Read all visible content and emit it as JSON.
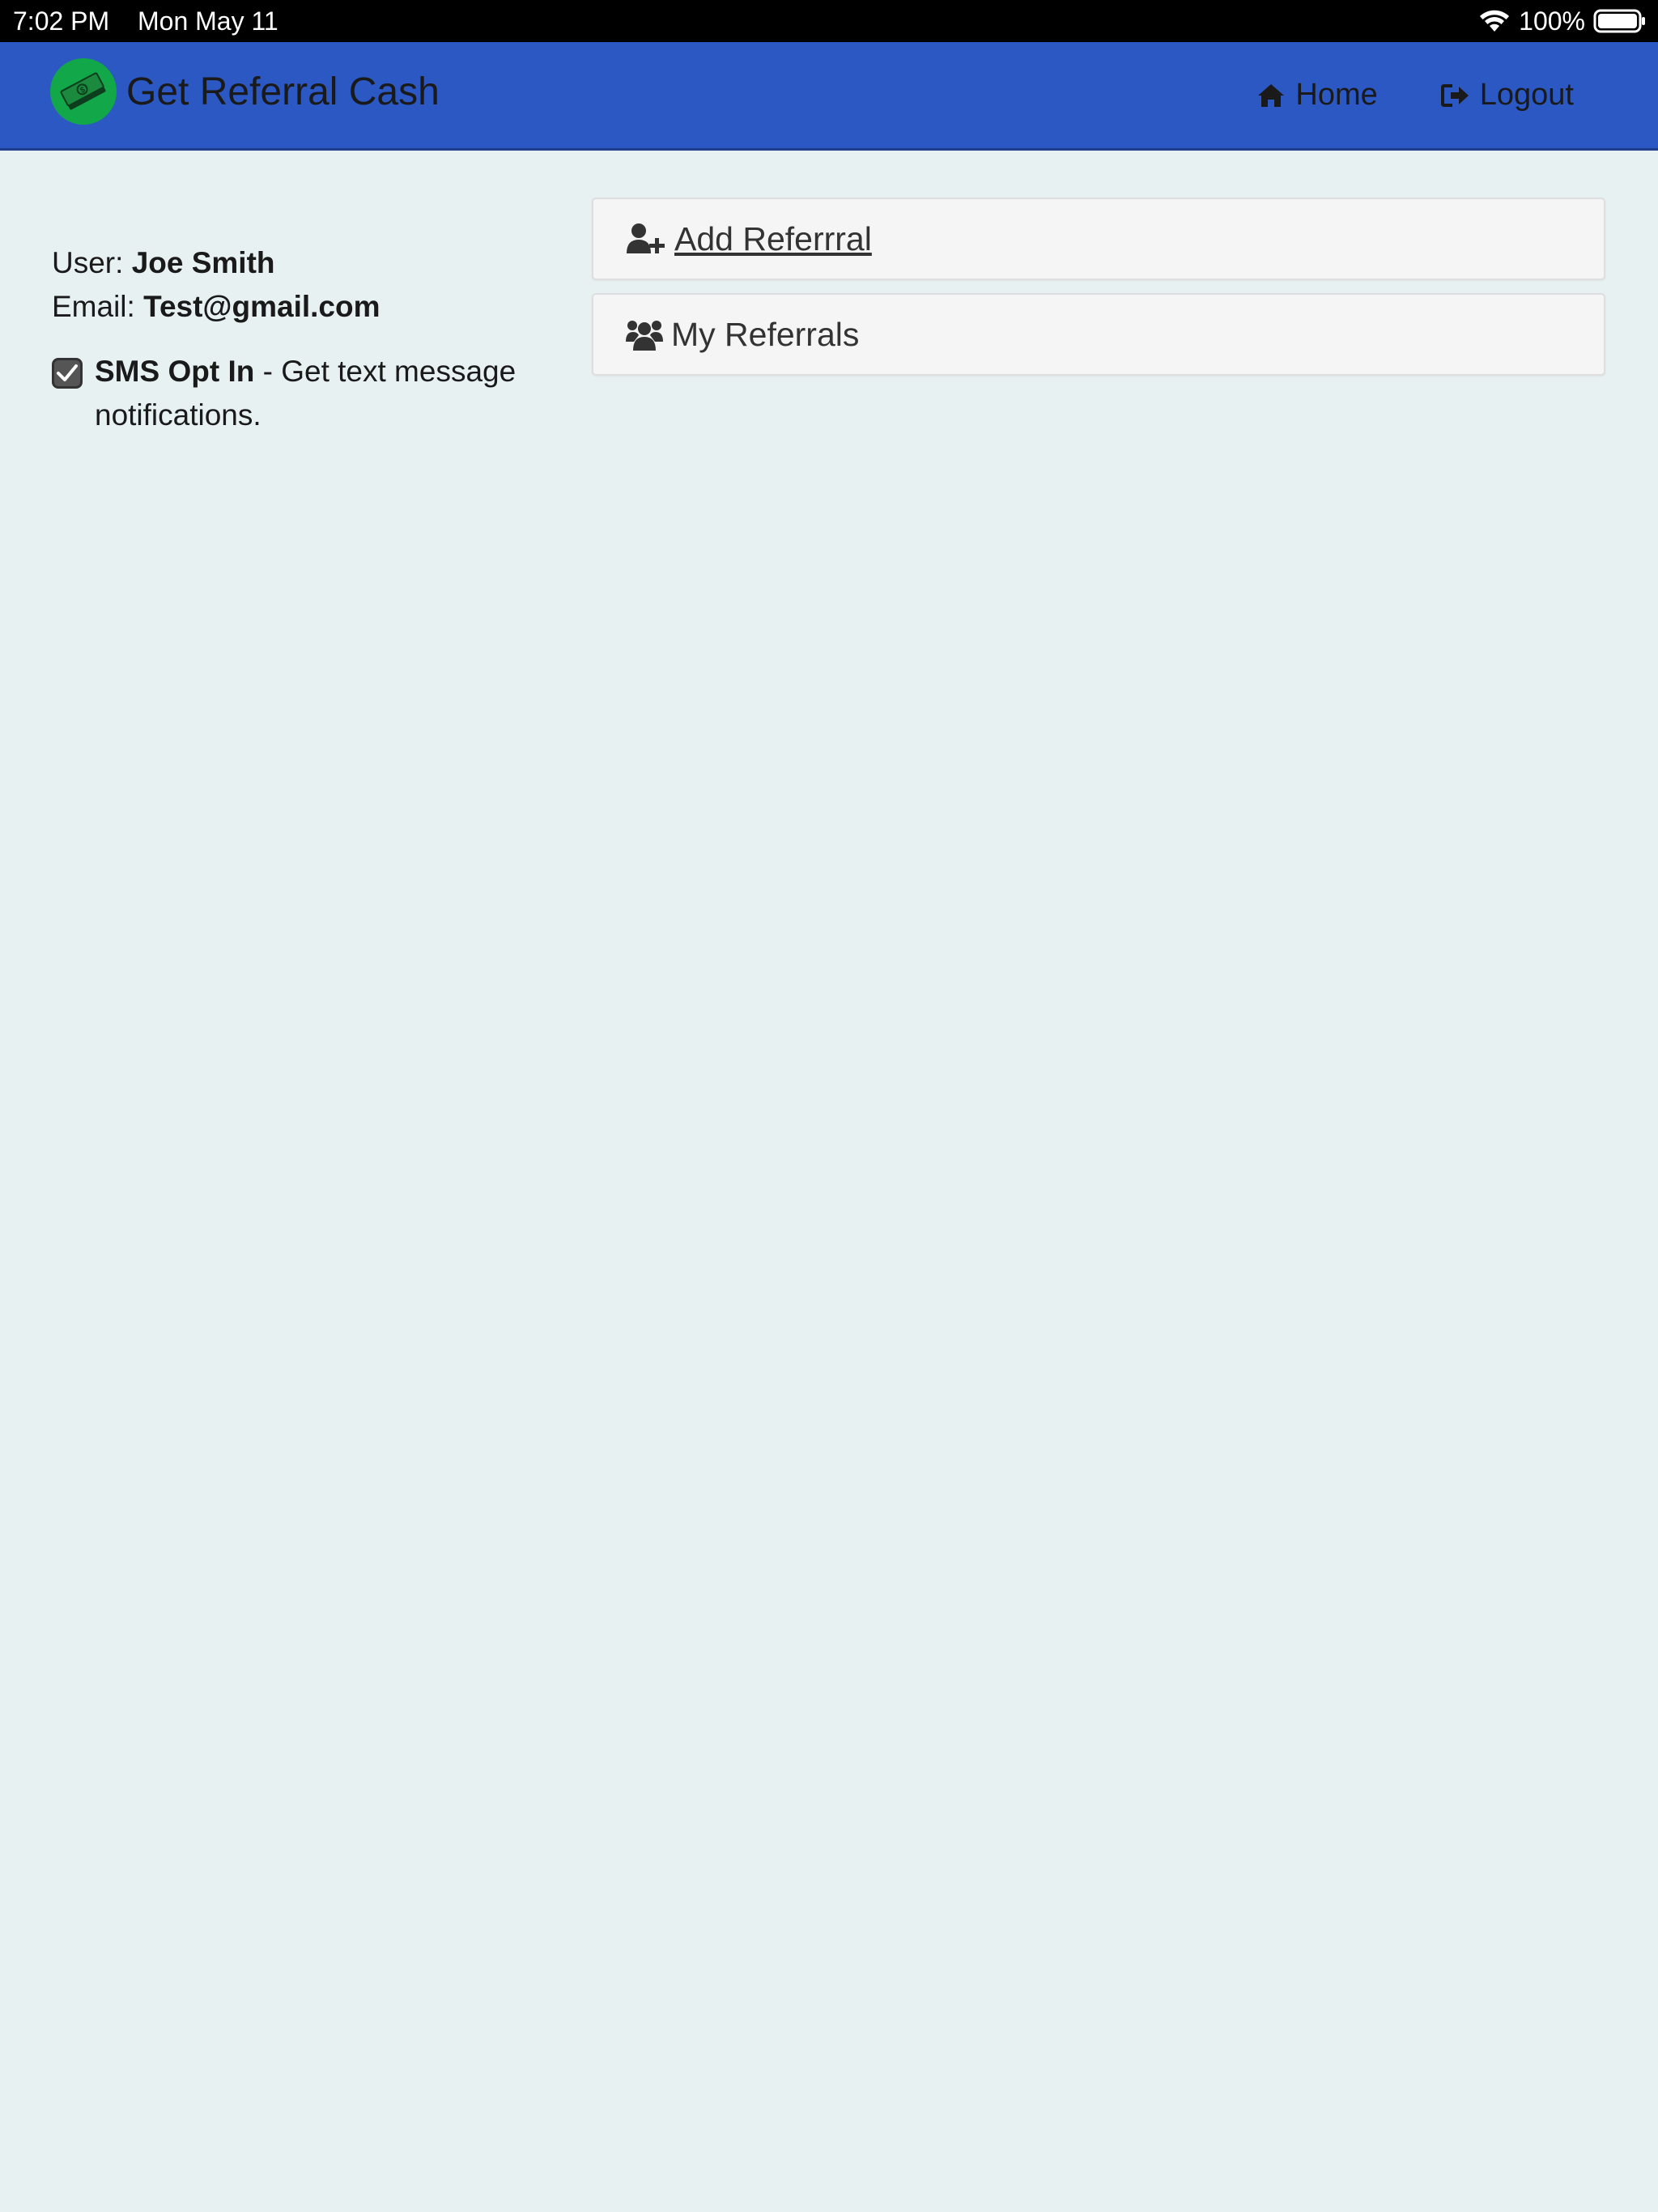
{
  "status_bar": {
    "time": "7:02 PM",
    "date": "Mon May 11",
    "battery": "100%",
    "icons": [
      "wifi-icon",
      "battery-icon"
    ]
  },
  "navbar": {
    "brand_title": "Get Referral Cash",
    "brand_icon": "money-icon",
    "home_label": "Home",
    "home_icon": "home-icon",
    "logout_label": "Logout",
    "logout_icon": "logout-icon",
    "colors": {
      "background": "#2b58c3",
      "logo": "#12a84a"
    }
  },
  "user": {
    "user_label": "User:",
    "name": "Joe Smith",
    "email_label": "Email:",
    "email": "Test@gmail.com",
    "sms_checked": true,
    "sms_title": "SMS Opt In",
    "sms_text": " - Get text message notifications."
  },
  "panels": {
    "add_referral": {
      "label": " Add Referrral",
      "icon": "user-plus-icon"
    },
    "my_referrals": {
      "label": "My Referrals",
      "icon": "users-icon"
    }
  }
}
